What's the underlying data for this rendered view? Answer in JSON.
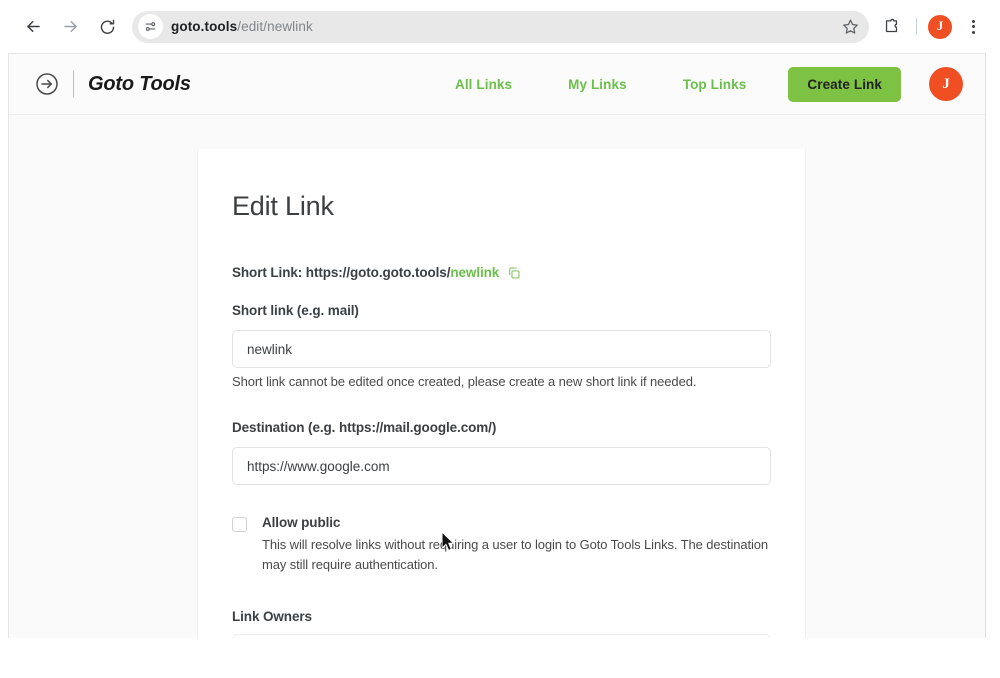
{
  "browser": {
    "back_icon": "arrow-left-icon",
    "forward_icon": "arrow-right-icon",
    "reload_icon": "reload-icon",
    "site_info_icon": "tune-icon",
    "url_host": "goto.tools",
    "url_path": "/edit/newlink",
    "bookmark_icon": "star-icon",
    "extensions_icon": "puzzle-icon",
    "profile_initial": "J",
    "menu_icon": "kebab-menu-icon"
  },
  "app_header": {
    "brand_icon": "arrow-circle-right-icon",
    "brand_name": "Goto Tools",
    "nav_links": [
      {
        "label": "All Links"
      },
      {
        "label": "My Links"
      },
      {
        "label": "Top Links"
      }
    ],
    "create_link_label": "Create Link",
    "avatar_initial": "J",
    "accent_green": "#7dc242",
    "avatar_orange": "#f04e23"
  },
  "main": {
    "title": "Edit Link",
    "short_link": {
      "prefix": "Short Link: https://goto.goto.tools/",
      "slug": "newlink",
      "copy_icon": "copy-icon"
    },
    "short_link_field": {
      "label": "Short link (e.g. mail)",
      "value": "newlink",
      "help": "Short link cannot be edited once created, please create a new short link if needed."
    },
    "destination_field": {
      "label": "Destination (e.g. https://mail.google.com/)",
      "value": "https://www.google.com"
    },
    "allow_public": {
      "label": "Allow public",
      "checked": false,
      "description": "This will resolve links without requiring a user to login to Goto Tools Links. The destination may still require authentication."
    },
    "link_owners": {
      "label": "Link Owners",
      "chips": [
        {
          "label": ""
        }
      ]
    }
  }
}
